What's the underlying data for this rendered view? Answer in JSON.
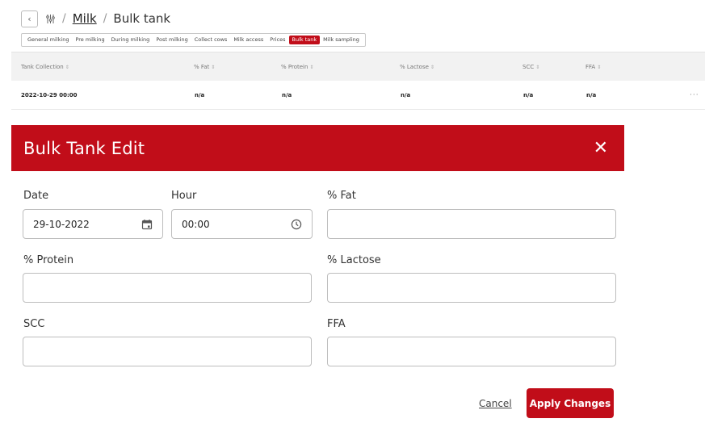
{
  "breadcrumb": {
    "section": "Milk",
    "page": "Bulk tank",
    "separator": "/"
  },
  "tabs": [
    {
      "label": "General milking",
      "active": false
    },
    {
      "label": "Pre milking",
      "active": false
    },
    {
      "label": "During milking",
      "active": false
    },
    {
      "label": "Post milking",
      "active": false
    },
    {
      "label": "Collect cows",
      "active": false
    },
    {
      "label": "Milk access",
      "active": false
    },
    {
      "label": "Prices",
      "active": false
    },
    {
      "label": "Bulk tank",
      "active": true
    },
    {
      "label": "Milk sampling",
      "active": false
    }
  ],
  "table": {
    "headers": [
      "Tank Collection",
      "% Fat",
      "% Protein",
      "% Lactose",
      "SCC",
      "FFA"
    ],
    "rows": [
      {
        "tank_collection": "2022-10-29 00:00",
        "fat": "n/a",
        "protein": "n/a",
        "lactose": "n/a",
        "scc": "n/a",
        "ffa": "n/a"
      }
    ],
    "sort_glyph": "⇕",
    "row_menu": "···"
  },
  "modal": {
    "title": "Bulk Tank Edit",
    "close_glyph": "✕",
    "fields": {
      "date": {
        "label": "Date",
        "value": "29-10-2022"
      },
      "hour": {
        "label": "Hour",
        "value": "00:00"
      },
      "fat": {
        "label": "% Fat",
        "value": ""
      },
      "protein": {
        "label": "% Protein",
        "value": ""
      },
      "lactose": {
        "label": "% Lactose",
        "value": ""
      },
      "scc": {
        "label": "SCC",
        "value": ""
      },
      "ffa": {
        "label": "FFA",
        "value": ""
      }
    },
    "cancel_label": "Cancel",
    "apply_label": "Apply Changes"
  },
  "colors": {
    "accent": "#c10d19",
    "header_bg": "#f2f2f2"
  },
  "icons": [
    "back-chevron-icon",
    "herd-icon",
    "sort-icon",
    "more-icon",
    "close-icon",
    "calendar-icon",
    "clock-icon"
  ]
}
